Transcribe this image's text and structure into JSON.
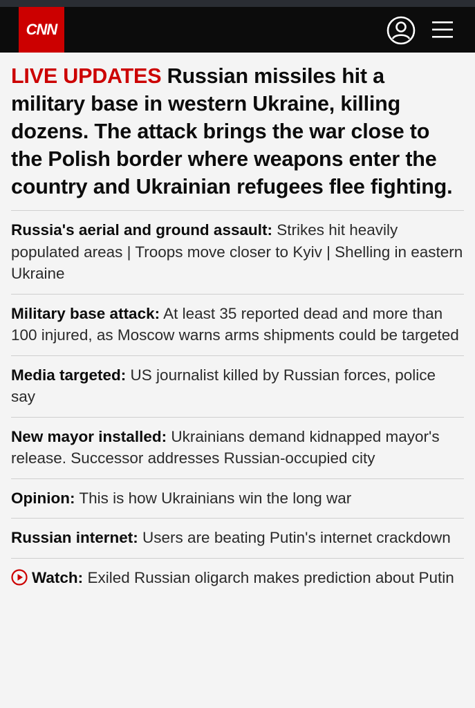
{
  "header": {
    "logo_text": "CNN",
    "brand_color": "#cc0000",
    "account_icon": "user-circle-icon",
    "menu_icon": "hamburger-menu-icon"
  },
  "headline": {
    "live_label": "LIVE UPDATES",
    "text": "Russian missiles hit a military base in western Ukraine, killing dozens. The attack brings the war close to the Polish border where weapons enter the country and Ukrainian refugees flee fighting."
  },
  "items": [
    {
      "lead": "Russia's aerial and ground assault:",
      "text": "Strikes hit heavily populated areas | Troops move closer to Kyiv | Shelling in eastern Ukraine"
    },
    {
      "lead": "Military base attack:",
      "text": "At least 35 reported dead and more than 100 injured, as Moscow warns arms shipments could be targeted"
    },
    {
      "lead": "Media targeted:",
      "text": "US journalist killed by Russian forces, police say"
    },
    {
      "lead": "New mayor installed:",
      "text": "Ukrainians demand kidnapped mayor's release. Successor addresses Russian-occupied city"
    },
    {
      "lead": "Opinion:",
      "text": "This is how Ukrainians win the long war"
    },
    {
      "lead": "Russian internet:",
      "text": "Users are beating Putin's internet crackdown"
    },
    {
      "lead": "Watch:",
      "text": "Exiled Russian oligarch makes prediction about Putin",
      "icon": "play-circle-icon"
    }
  ]
}
